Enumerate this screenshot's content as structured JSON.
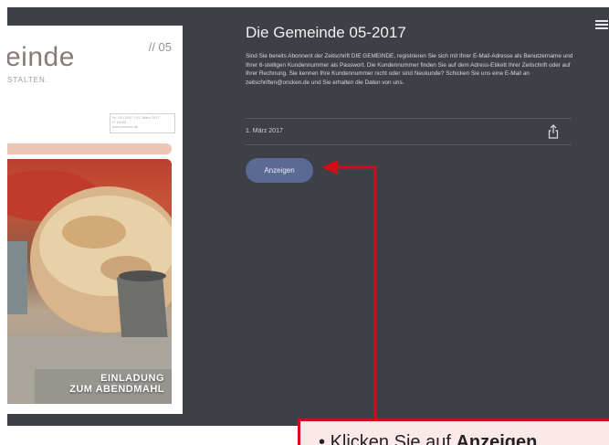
{
  "cover": {
    "brand_fragment": "einde",
    "issue": "// 05",
    "tagline_fragment": "STALTEN.",
    "meta_line1": "Nr. 05 | 2017 | 01. März 2017",
    "meta_line2": "H 10040",
    "meta_line3": "www.oncken.de",
    "headline_line1": "EINLADUNG",
    "headline_line2": "ZUM ABENDMAHL"
  },
  "detail": {
    "title": "Die Gemeinde 05-2017",
    "description": "Sind Sie bereits Abonnent der Zeitschrift DIE GEMEINDE, registrieren Sie sich mit Ihrer E-Mail-Adresse als Benutzername und Ihrer 6-stelligen Kundennummer als Passwort. Die Kundennummer finden Sie auf dem Adress-Etikett Ihrer Zeitschrift oder auf Ihrer Rechnung. Sie kennen Ihre Kundennummer nicht oder sind Neukunde? Schicken Sie uns eine E-Mail an zeitschriften@oncken.de und Sie erhalten die Daten von uns.",
    "date": "1. März 2017",
    "show_button_label": "Anzeigen"
  },
  "annotation": {
    "bullet": "•",
    "prefix": "Klicken Sie auf ",
    "target": "Anzeigen"
  },
  "icons": {
    "menu": "hamburger-menu-icon",
    "share": "share-icon",
    "arrow": "arrow-left-icon"
  },
  "colors": {
    "panel_bg": "#3d4147",
    "button_bg": "#5b6a95",
    "annotation_red": "#d10d1a",
    "annotation_box": "#fbe9e9"
  }
}
